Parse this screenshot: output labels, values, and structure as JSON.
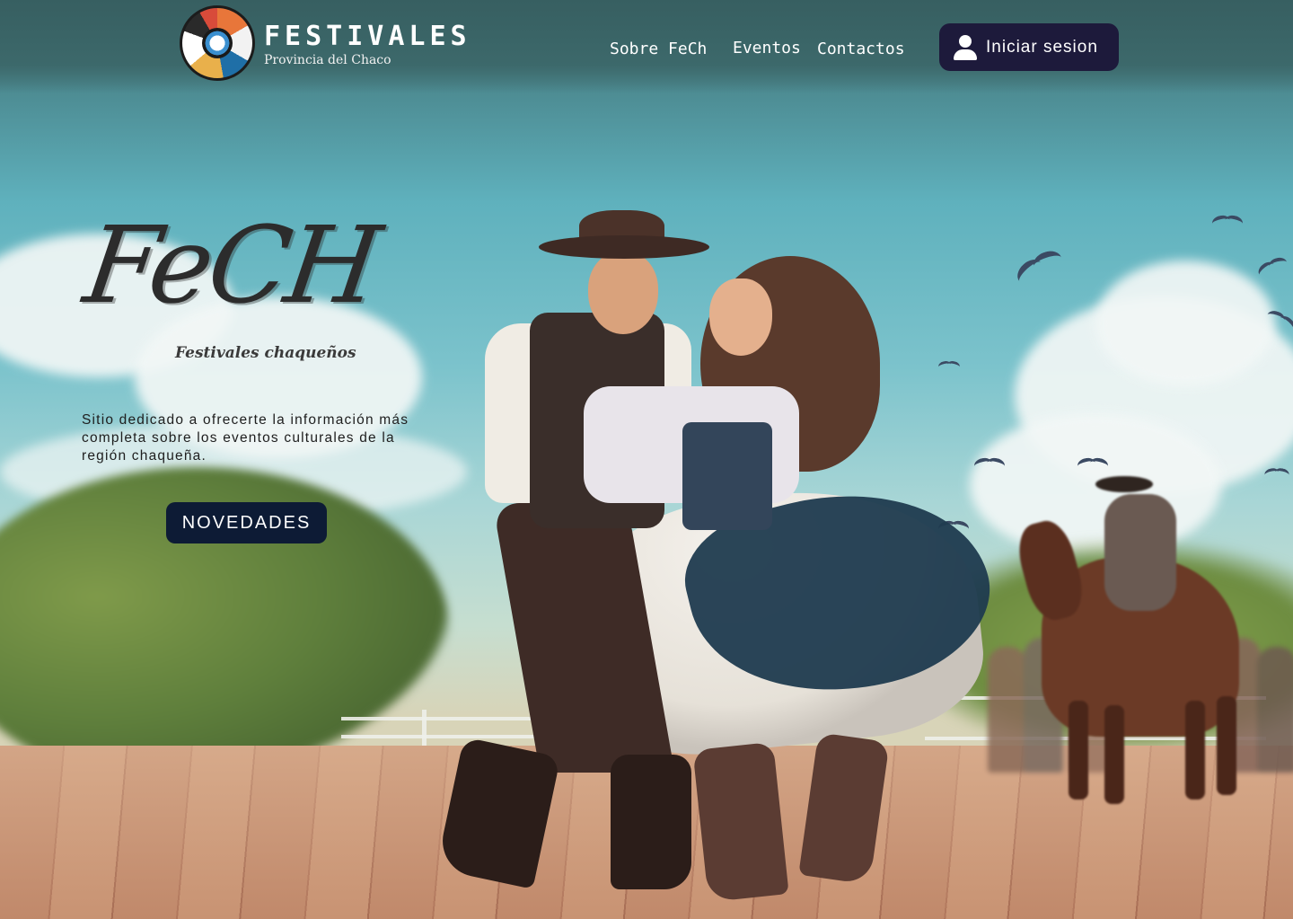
{
  "header": {
    "brand_title": "FESTIVALES",
    "brand_subtitle": "Provincia del Chaco",
    "logo_icon": "festival-collage-logo",
    "nav": [
      {
        "label": "Sobre FeCh"
      },
      {
        "label": "Eventos"
      },
      {
        "label": "Contactos"
      }
    ],
    "login": {
      "label": "Iniciar sesion",
      "icon": "user-icon"
    }
  },
  "hero": {
    "title": "FeCH",
    "subtitle": "Festivales chaqueños",
    "description": "Sitio dedicado a ofrecerte la información más completa sobre los eventos culturales de la región chaqueña.",
    "cta_label": "NOVEDADES"
  },
  "colors": {
    "header_bg": "#3a6668",
    "login_bg": "#1d1a3b",
    "cta_bg": "#0d1b35",
    "text_light": "#ffffff"
  }
}
